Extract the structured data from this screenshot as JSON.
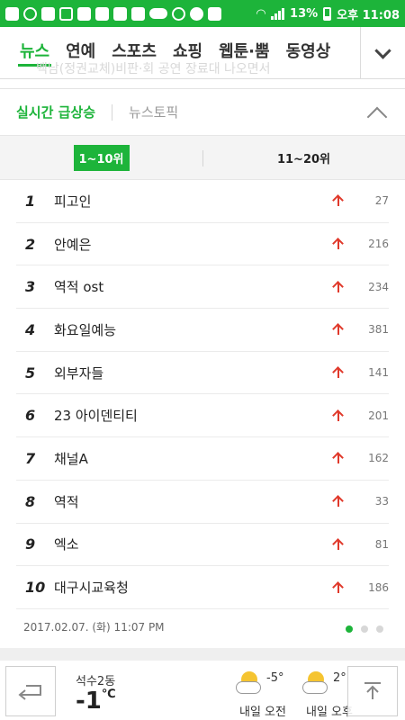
{
  "status_bar": {
    "battery": "13%",
    "clock": "오후 11:08",
    "icons": [
      "app-icon",
      "app-icon",
      "notification-icon",
      "sim-icon",
      "app-icon",
      "app-icon",
      "app-icon",
      "app-icon",
      "chat-icon",
      "vibrate-icon",
      "twitter-icon",
      "app-icon",
      "wifi-icon",
      "signal-icon",
      "battery-icon"
    ]
  },
  "nav": {
    "tabs": [
      "뉴스",
      "연예",
      "스포츠",
      "쇼핑",
      "웹툰·뿜",
      "동영상"
    ],
    "active_index": 0,
    "ghost_text": "백남(정권교체)비판·회 공연 장료대 나오면서"
  },
  "section": {
    "title": "실시간 급상승",
    "alt_tab": "뉴스토픽"
  },
  "range_tabs": {
    "first": "1~10위",
    "second": "11~20위"
  },
  "ranking": [
    {
      "rank": "1",
      "keyword": "피고인",
      "count": "27"
    },
    {
      "rank": "2",
      "keyword": "안예은",
      "count": "216"
    },
    {
      "rank": "3",
      "keyword": "역적 ost",
      "count": "234"
    },
    {
      "rank": "4",
      "keyword": "화요일예능",
      "count": "381"
    },
    {
      "rank": "5",
      "keyword": "외부자들",
      "count": "141"
    },
    {
      "rank": "6",
      "keyword": "23 아이덴티티",
      "count": "201"
    },
    {
      "rank": "7",
      "keyword": "채널A",
      "count": "162"
    },
    {
      "rank": "8",
      "keyword": "역적",
      "count": "33"
    },
    {
      "rank": "9",
      "keyword": "엑소",
      "count": "81"
    },
    {
      "rank": "10",
      "keyword": "대구시교육청",
      "count": "186"
    }
  ],
  "timestamp": "2017.02.07. (화) 11:07 PM",
  "pagination": {
    "pages": 3,
    "current": 1
  },
  "weather": {
    "location": "석수2동",
    "temperature": "-1",
    "unit": "℃",
    "forecast": [
      {
        "label": "내일 오전",
        "temp": "-5°",
        "icon": "sun-cloud-icon"
      },
      {
        "label": "내일 오후",
        "temp": "2°",
        "icon": "sun-cloud-icon"
      }
    ]
  },
  "colors": {
    "accent": "#1db43a",
    "up_arrow": "#e0392b"
  }
}
